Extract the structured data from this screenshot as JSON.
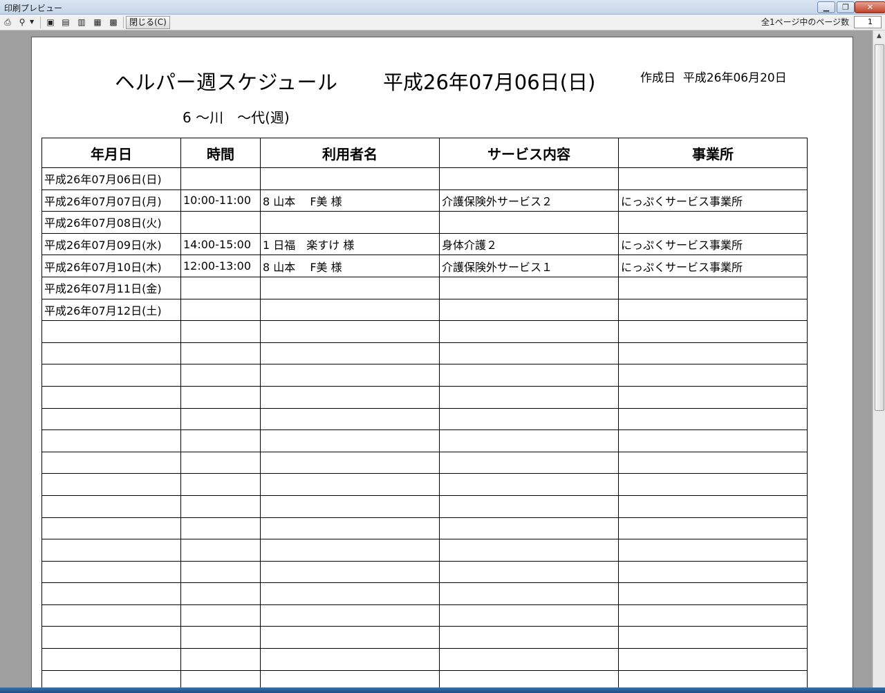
{
  "window": {
    "title": "印刷プレビュー"
  },
  "toolbar": {
    "close_label": "閉じる(C)",
    "page_count_label": "全1ページ中のページ数",
    "page_number": "1"
  },
  "document": {
    "title": "ヘルパー週スケジュール",
    "date": "平成26年07月06日(日)",
    "created_label": "作成日",
    "created_date": "平成26年06月20日",
    "subtitle": "6 ～川　～代(週)",
    "columns": [
      "年月日",
      "時間",
      "利用者名",
      "サービス内容",
      "事業所"
    ],
    "rows": [
      [
        "平成26年07月06日(日)",
        "",
        "",
        "",
        ""
      ],
      [
        "平成26年07月07日(月)",
        "10:00-11:00",
        "8 山本　 F美 様",
        "介護保険外サービス２",
        "にっぷくサービス事業所"
      ],
      [
        "平成26年07月08日(火)",
        "",
        "",
        "",
        ""
      ],
      [
        "平成26年07月09日(水)",
        "14:00-15:00",
        "1 日福　楽すけ 様",
        "身体介護２",
        "にっぷくサービス事業所"
      ],
      [
        "平成26年07月10日(木)",
        "12:00-13:00",
        "8 山本　 F美 様",
        "介護保険外サービス１",
        "にっぷくサービス事業所"
      ],
      [
        "平成26年07月11日(金)",
        "",
        "",
        "",
        ""
      ],
      [
        "平成26年07月12日(土)",
        "",
        "",
        "",
        ""
      ]
    ],
    "empty_rows": 17
  }
}
